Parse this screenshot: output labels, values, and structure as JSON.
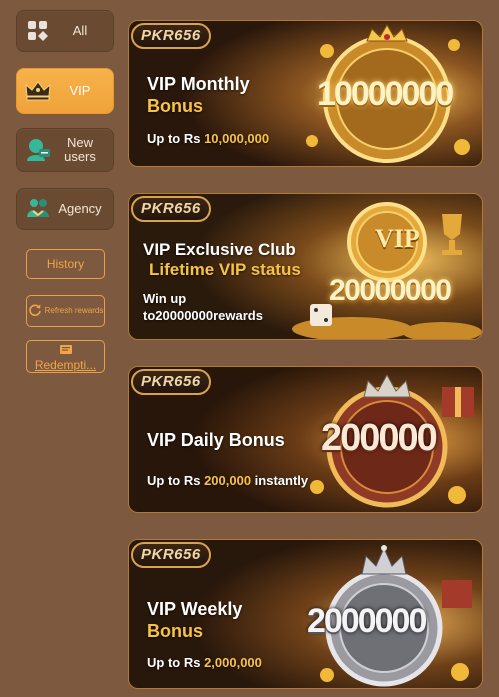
{
  "sidebar": {
    "items": [
      {
        "label": "All",
        "icon": "grid-icon"
      },
      {
        "label": "VIP",
        "icon": "crown-icon",
        "active": true
      },
      {
        "label": "New users",
        "icon": "new-user-icon"
      },
      {
        "label": "Agency",
        "icon": "agency-icon"
      }
    ],
    "history_label": "History",
    "refresh_label": "Refresh rewards",
    "redemption_label": "Redempti..."
  },
  "cards": [
    {
      "tag": "PKR656",
      "title_line1": "VIP Monthly",
      "title_line2": "Bonus",
      "sub_prefix": "Up to Rs ",
      "sub_highlight": "10,000,000",
      "sub_suffix": "",
      "art_number": "10000000"
    },
    {
      "tag": "PKR656",
      "title_line1": "VIP Exclusive Club",
      "title_line2": "Lifetime VIP status",
      "sub_line1": "Win up",
      "sub_line2": "to20000000rewards",
      "art_badge": "VIP",
      "art_number": "20000000"
    },
    {
      "tag": "PKR656",
      "title_line1": "VIP Daily Bonus",
      "sub_prefix": "Up to Rs ",
      "sub_highlight": "200,000",
      "sub_suffix": " instantly",
      "art_number": "200000"
    },
    {
      "tag": "PKR656",
      "title_line1": "VIP Weekly",
      "title_line2": "Bonus",
      "sub_prefix": "Up to Rs ",
      "sub_highlight": "2,000,000",
      "sub_suffix": "",
      "art_number": "2000000"
    }
  ],
  "colors": {
    "page_bg": "#7d5a3f",
    "active_tab": "#f0a23a",
    "highlight": "#f7c345",
    "outline_btn": "#e6a14a"
  }
}
